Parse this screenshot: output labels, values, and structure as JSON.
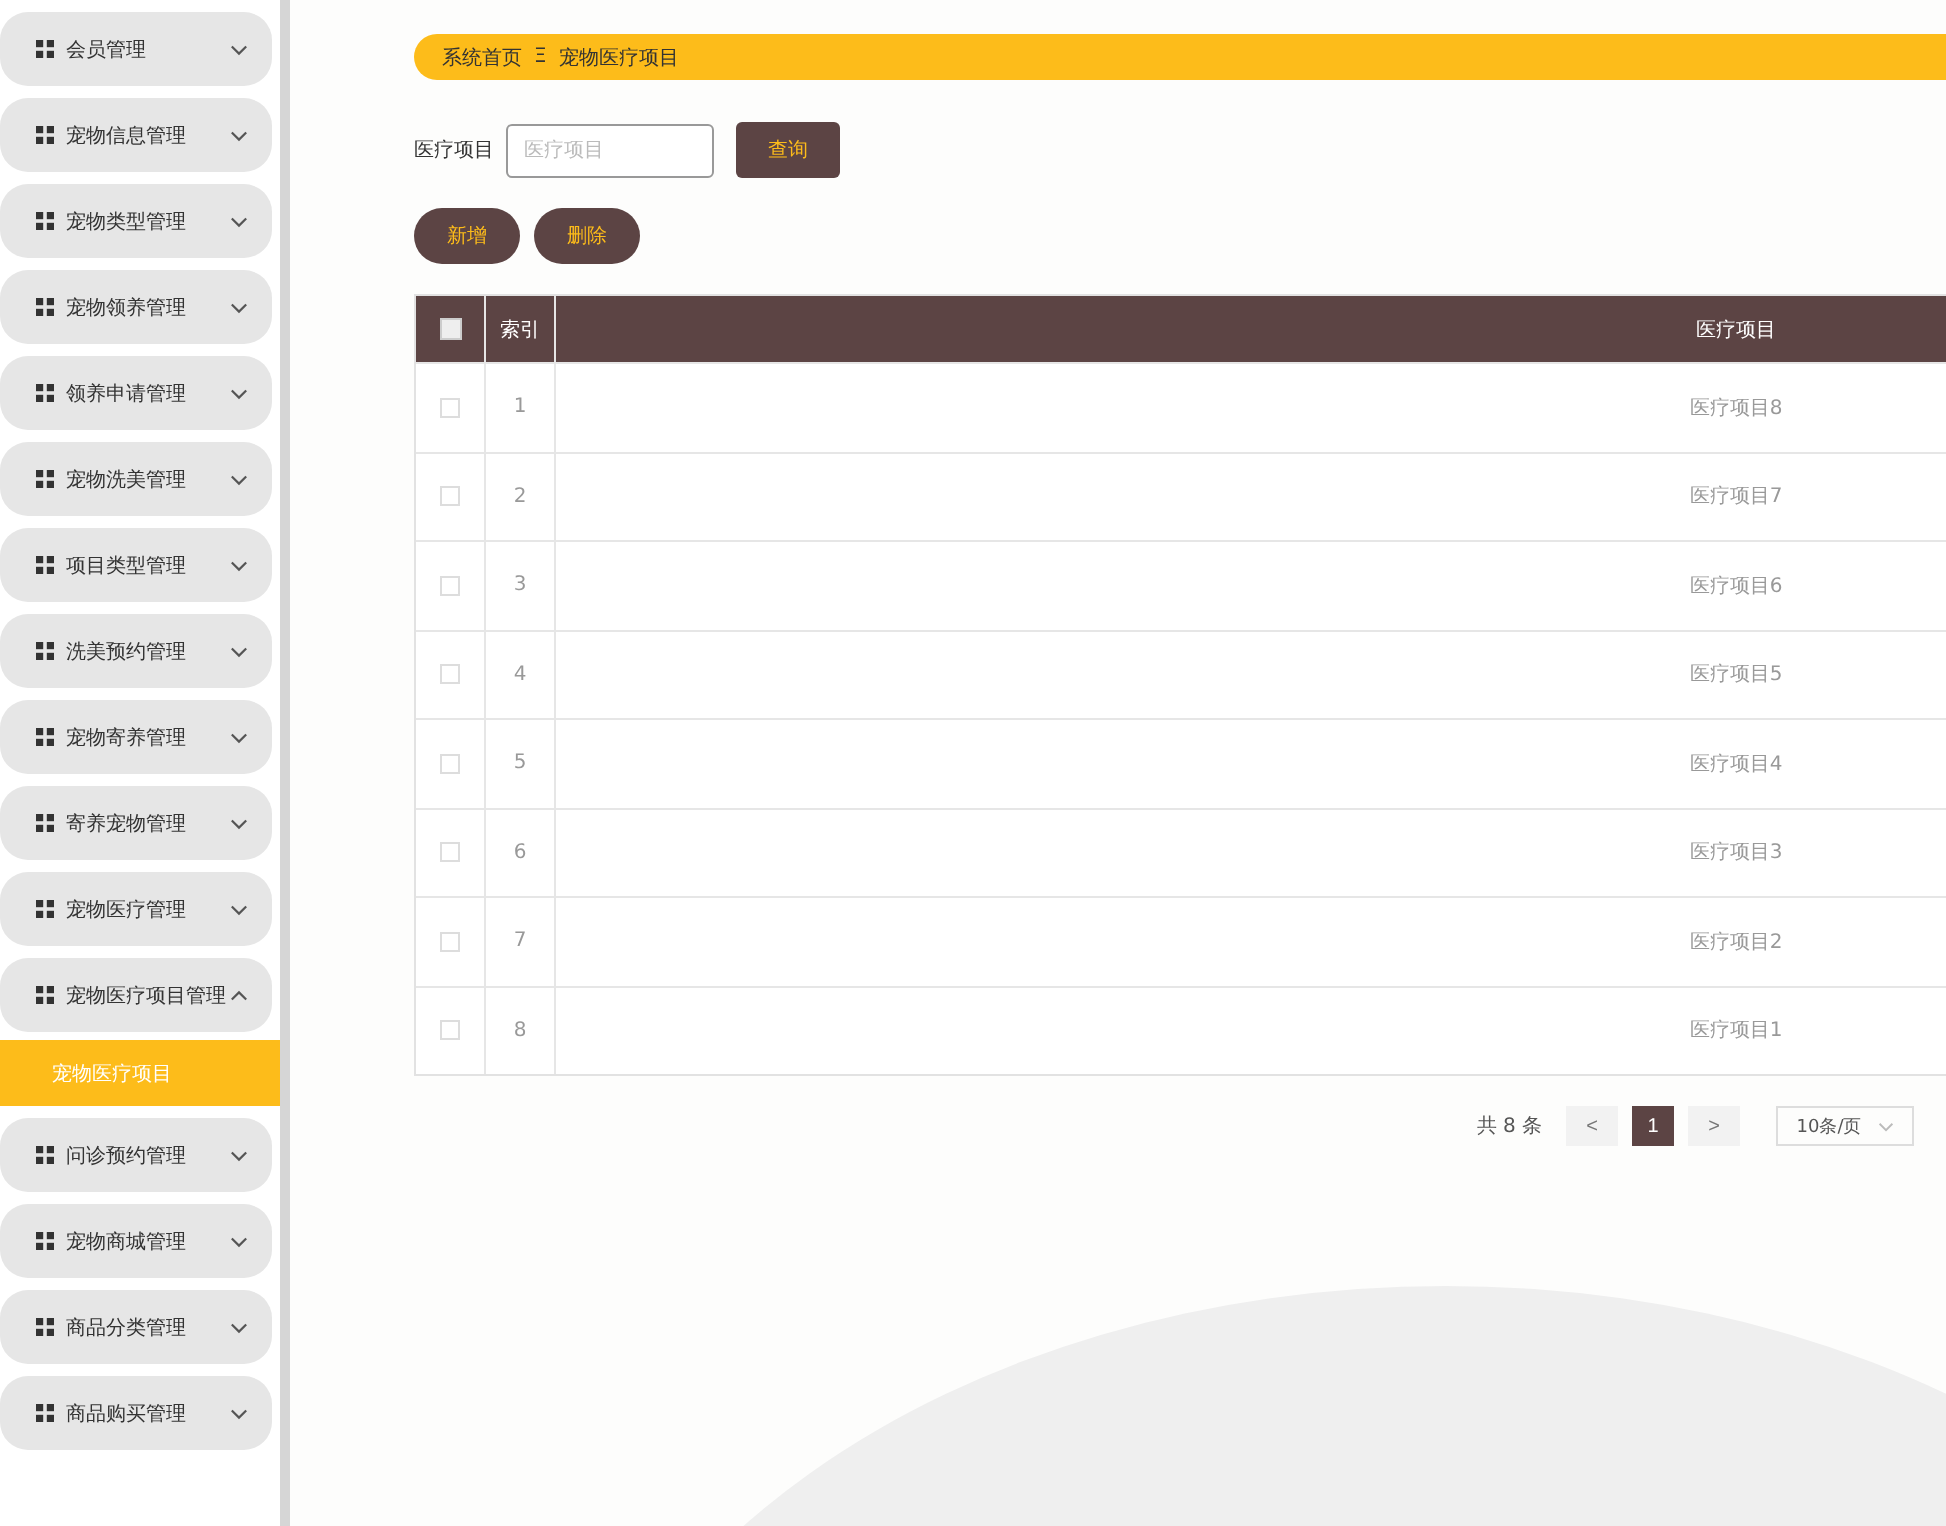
{
  "sidebar": {
    "items": [
      {
        "label": "会员管理",
        "expanded": false
      },
      {
        "label": "宠物信息管理",
        "expanded": false
      },
      {
        "label": "宠物类型管理",
        "expanded": false
      },
      {
        "label": "宠物领养管理",
        "expanded": false
      },
      {
        "label": "领养申请管理",
        "expanded": false
      },
      {
        "label": "宠物洗美管理",
        "expanded": false
      },
      {
        "label": "项目类型管理",
        "expanded": false
      },
      {
        "label": "洗美预约管理",
        "expanded": false
      },
      {
        "label": "宠物寄养管理",
        "expanded": false
      },
      {
        "label": "寄养宠物管理",
        "expanded": false
      },
      {
        "label": "宠物医疗管理",
        "expanded": false
      },
      {
        "label": "宠物医疗项目管理",
        "expanded": true,
        "children": [
          {
            "label": "宠物医疗项目",
            "selected": true
          }
        ]
      },
      {
        "label": "问诊预约管理",
        "expanded": false
      },
      {
        "label": "宠物商城管理",
        "expanded": false
      },
      {
        "label": "商品分类管理",
        "expanded": false
      },
      {
        "label": "商品购买管理",
        "expanded": false
      }
    ]
  },
  "breadcrumb": {
    "home": "系统首页",
    "separator": "Ξ",
    "current": "宠物医疗项目"
  },
  "search": {
    "label": "医疗项目",
    "placeholder": "医疗项目",
    "button": "查询"
  },
  "actions": [
    "新增",
    "删除"
  ],
  "table": {
    "columns": [
      "索引",
      "医疗项目"
    ],
    "all_checked": false,
    "rows": [
      {
        "index": "1",
        "name": "医疗项目8",
        "checked": false
      },
      {
        "index": "2",
        "name": "医疗项目7",
        "checked": false
      },
      {
        "index": "3",
        "name": "医疗项目6",
        "checked": false
      },
      {
        "index": "4",
        "name": "医疗项目5",
        "checked": false
      },
      {
        "index": "5",
        "name": "医疗项目4",
        "checked": false
      },
      {
        "index": "6",
        "name": "医疗项目3",
        "checked": false
      },
      {
        "index": "7",
        "name": "医疗项目2",
        "checked": false
      },
      {
        "index": "8",
        "name": "医疗项目1",
        "checked": false
      }
    ]
  },
  "pagination": {
    "total": "共 8 条",
    "prev": "<",
    "pages": [
      {
        "label": "1",
        "selected": true
      }
    ],
    "next": ">",
    "page_size": "10条/页"
  }
}
